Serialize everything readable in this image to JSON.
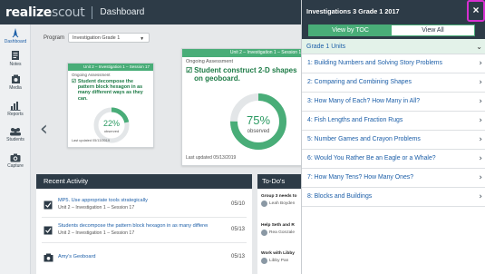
{
  "header": {
    "brand_realize": "realize",
    "brand_scout": "scout",
    "title": "Dashboard"
  },
  "rail": {
    "items": [
      {
        "label": "Dashboard",
        "icon": "compass-icon"
      },
      {
        "label": "Notes",
        "icon": "notes-icon"
      },
      {
        "label": "Media",
        "icon": "media-icon"
      },
      {
        "label": "Reports",
        "icon": "reports-icon"
      },
      {
        "label": "Students",
        "icon": "students-icon"
      },
      {
        "label": "Capture",
        "icon": "camera-icon"
      }
    ]
  },
  "program": {
    "label": "Program",
    "value": "Investigation Grade 1"
  },
  "card_small": {
    "band": "Unit 2 – Investigation 1 – Session 17",
    "kind": "Ongoing Assessment",
    "objective": "Student decompose the pattern block hexagon in as many different ways as they can.",
    "percent": "22%",
    "percent_label": "observed",
    "percent_value": 22,
    "updated": "Last updated 05/13/2019"
  },
  "card_main": {
    "band": "Unit 2 – Investigation 1 – Session 16",
    "kind": "Ongoing Assessment",
    "objective": "Student construct 2-D shapes on geoboard.",
    "percent": "75%",
    "percent_label": "observed",
    "percent_value": 75,
    "updated": "Last updated 05/13/2019"
  },
  "recent": {
    "title": "Recent Activity",
    "rows": [
      {
        "text": "MP5. Use appropriate tools strategically",
        "sub": "Unit 2 – Investigation 1 – Session 17",
        "date": "05/10"
      },
      {
        "text": "Students decompose the pattern block hexagon in as many different ways as th...",
        "sub": "Unit 2 – Investigation 1 – Session 17",
        "date": "05/13"
      },
      {
        "text": "Amy's Geoboard",
        "sub": "",
        "date": "05/13"
      }
    ]
  },
  "todo": {
    "title": "To-Do's",
    "items": [
      {
        "text": "Group 3 needs to",
        "who": "Leah Boyden"
      },
      {
        "text": "Help Seth and R",
        "who": "Rea Gonzale"
      },
      {
        "text": "Work with Libby",
        "who": "Libby Pan"
      }
    ]
  },
  "panel": {
    "title": "Investigations 3 Grade 1 2017",
    "close_label": "×",
    "toggle_on": "View by TOC",
    "toggle_off": "View All",
    "units_header": "Grade 1 Units",
    "units": [
      "1: Building Numbers and Solving Story Problems",
      "2: Comparing and Combining Shapes",
      "3: How Many of Each? How Many in All?",
      "4: Fish Lengths and Fraction Rugs",
      "5: Number Games and Crayon Problems",
      "6: Would You Rather Be an Eagle or a Whale?",
      "7: How Many Tens? How Many Ones?",
      "8: Blocks and Buildings"
    ]
  },
  "colors": {
    "navy": "#2d3b47",
    "green": "#49ad78",
    "link_blue": "#1d5fa8",
    "highlight_magenta": "#d62fd0"
  }
}
